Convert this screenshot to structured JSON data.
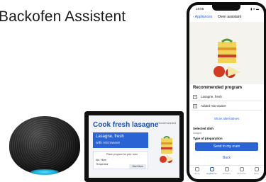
{
  "headline": "Backofen Assistent",
  "display": {
    "title": "Cook fresh lasagne",
    "brand": "HomeConnect",
    "panel_line1": "Lasagne, fresh",
    "panel_line2": "with microwave",
    "info_text": "Place program for your oven",
    "field1": "Abl. Hitze",
    "field2": "Temperatur",
    "button": "Start Now"
  },
  "phone": {
    "time": "18:06",
    "status": "▮ ≋ ▬",
    "nav_back": "‹ Appliances",
    "nav_title": "Oven assistant",
    "section_title": "Recommended program",
    "rows": [
      {
        "icon": "+",
        "text": "Lasagne, fresh"
      },
      {
        "icon": "≡",
        "text": "Added microwave"
      }
    ],
    "show_alternatives": "Show alternatives",
    "selected_dish_label": "Selected dish",
    "selected_dish_value": "lasagne",
    "type_label": "Type of preparation",
    "primary_button": "Send to my oven",
    "back_link": "Back",
    "tabs": [
      "Home",
      "Appliances",
      "Recipes",
      "Moments",
      "More"
    ],
    "active_tab": 1
  },
  "colors": {
    "accent": "#2a63d4",
    "speaker_ring": "#1aa8d6"
  }
}
